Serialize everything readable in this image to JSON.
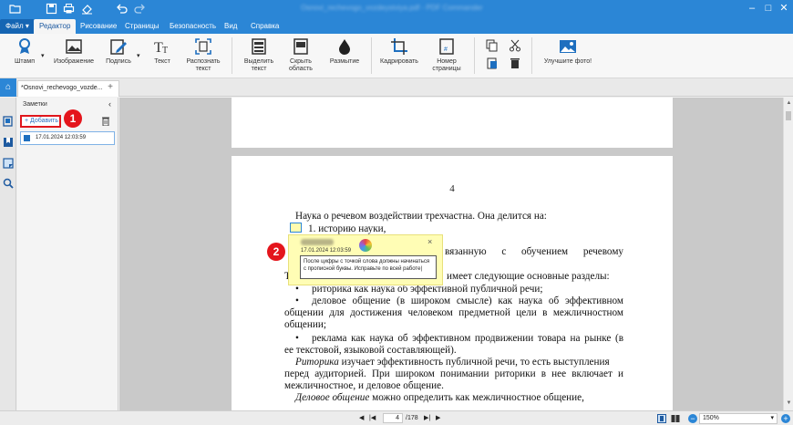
{
  "colors": {
    "accent": "#2b86d6",
    "badge": "#e4151c",
    "note_bg": "#fffdb5"
  },
  "titlebar": {
    "title": "Osnovi_rechevogo_vozdeystviya.pdf - PDF Commander",
    "quick_access": [
      "folder-icon",
      "save-icon",
      "print-icon",
      "scan-icon",
      "undo-icon",
      "redo-icon"
    ],
    "window_controls": [
      "minimize-icon",
      "maximize-icon",
      "close-icon"
    ]
  },
  "ribbon_tabs": {
    "file": "Файл",
    "tabs": [
      "Редактор",
      "Рисование",
      "Страницы",
      "Безопасность",
      "Вид",
      "Справка"
    ]
  },
  "ribbon": {
    "stamp": "Штамп",
    "image": "Изображение",
    "signature": "Подпись",
    "text": "Текст",
    "recognize_1": "Распознать",
    "recognize_2": "текст",
    "highlight_1": "Выделить",
    "highlight_2": "текст",
    "hide_1": "Скрыть",
    "hide_2": "область",
    "blur": "Размытие",
    "crop": "Кадрировать",
    "pagenum_1": "Номер",
    "pagenum_2": "страницы",
    "improve": "Улучшите фото!"
  },
  "doc_tab": {
    "title": "*Osnovi_rechevogo_vozde...",
    "add": "+"
  },
  "notes_panel": {
    "title": "Заметки",
    "add_button": "+ Добавить",
    "items": [
      {
        "date": "17.01.2024 12:03:59"
      }
    ]
  },
  "document": {
    "page_number": "4",
    "lines": {
      "l1": "Наука о речевом воздействии трехчастна. Она делится на:",
      "l2": "1.  историю науки,",
      "l3": "2.",
      "l4": "вязанную   с   обучением   речевому",
      "l5": "Т",
      "l6": "имеет следующие основные разделы:",
      "l7": "риторика как наука об эффективной публичной речи;",
      "l8": "деловое   общение  (в  широком  смысле)  как   наука  об  эффективном",
      "l9": "общении для достижения человеком   предметной   цели в межличностном",
      "l10": "общении;",
      "l11": "реклама как наука об эффективном продвижении товара на рынке (в",
      "l12": "ее текстовой, языковой составляющей).",
      "l13_italic": "Риторика",
      "l13_rest": "  изучает эффективность публичной речи, то есть выступления",
      "l14": "перед аудиторией. При широком понимании риторики в нее включает и",
      "l15": "межличностное, и деловое общение.",
      "l16_italic": "Деловое   общение",
      "l16_rest": "  можно  определить  как  межличностное  общение,",
      "bullet": "•"
    }
  },
  "note_popup": {
    "author": "Заметка",
    "date": "17.01.2024 12:03:59",
    "text": "После цифры с точкой слова должны начинаться с прописной буквы. Исправьте по всей работе|",
    "close": "×"
  },
  "badges": {
    "one": "1",
    "two": "2"
  },
  "status": {
    "current_page": "4",
    "total_pages": "/178",
    "zoom": "150%",
    "zoom_out": "−",
    "zoom_in": "+"
  }
}
